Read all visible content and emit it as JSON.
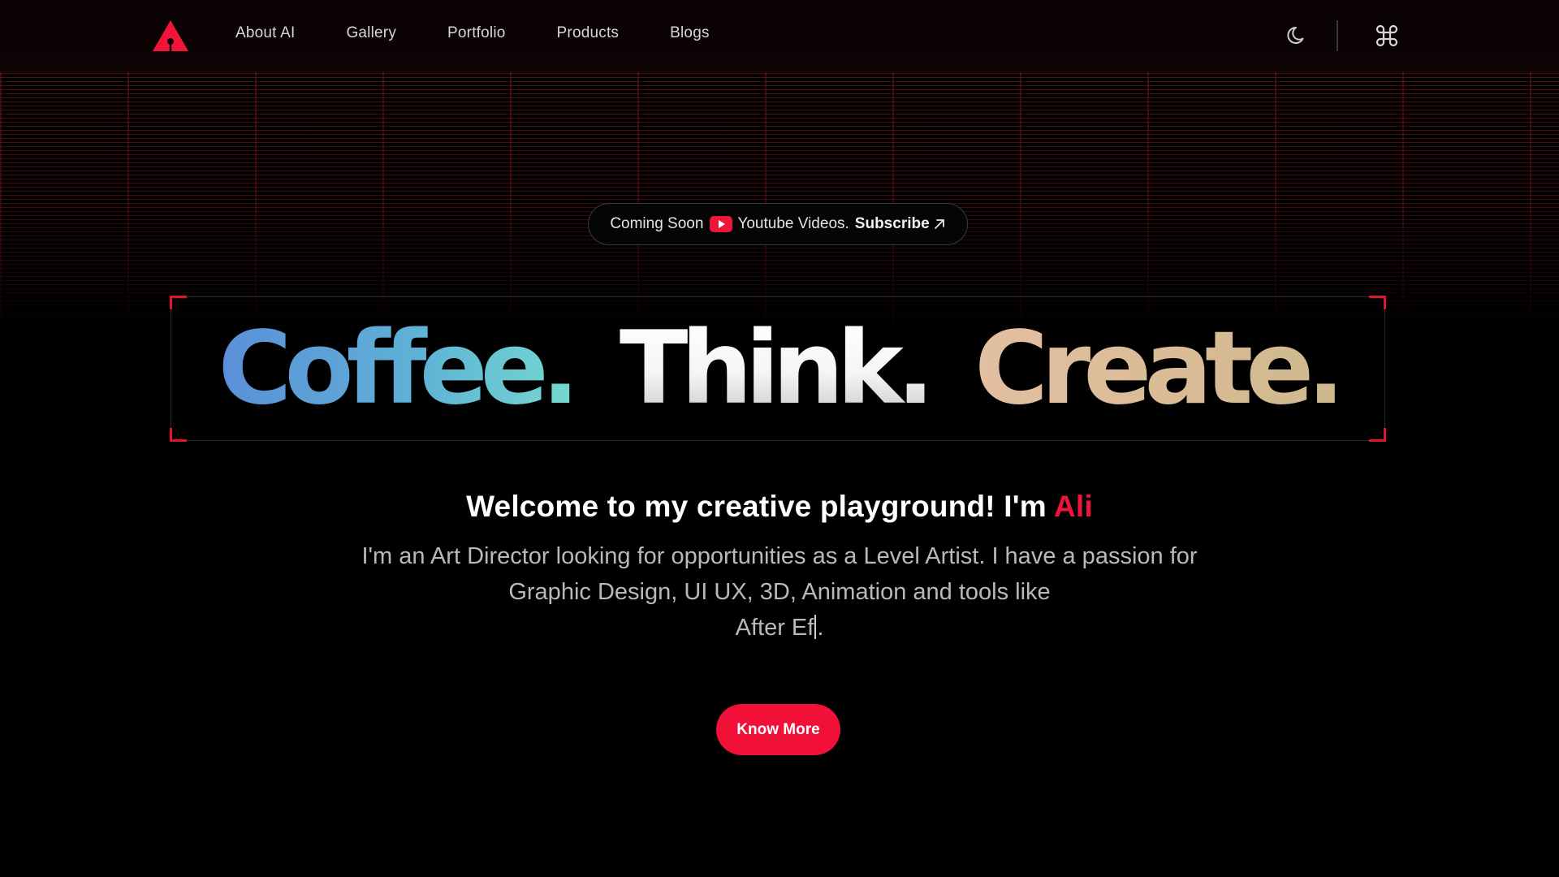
{
  "nav": {
    "logo_icon": "triangle-logo-icon",
    "links": [
      {
        "label": "About AI"
      },
      {
        "label": "Gallery"
      },
      {
        "label": "Portfolio"
      },
      {
        "label": "Products"
      },
      {
        "label": "Blogs"
      }
    ],
    "theme_toggle_icon": "moon-icon",
    "command_icon": "command-key-icon"
  },
  "announcement": {
    "prefix": "Coming Soon",
    "youtube_icon": "youtube-icon",
    "text": "Youtube Videos.",
    "action": "Subscribe",
    "action_icon": "arrow-up-right-icon"
  },
  "hero": {
    "words": [
      "Coffee.",
      "Think.",
      "Create."
    ]
  },
  "welcome": {
    "text": "Welcome to my creative playground! I'm ",
    "name": "Ali"
  },
  "description": {
    "line1": "I'm an Art Director looking for opportunities as a Level Artist. I have a passion for",
    "line2": "Graphic Design, UI UX, 3D, Animation and tools like",
    "line3_before_cursor": "After Ef",
    "line3_after_cursor": "."
  },
  "cta": {
    "label": "Know More"
  },
  "colors": {
    "accent": "#f01038",
    "background": "#000000",
    "coffee_gradient": [
      "#5b8fd8",
      "#74d8d0"
    ],
    "create_gradient": [
      "#e2bfa1",
      "#cdb98d"
    ]
  }
}
